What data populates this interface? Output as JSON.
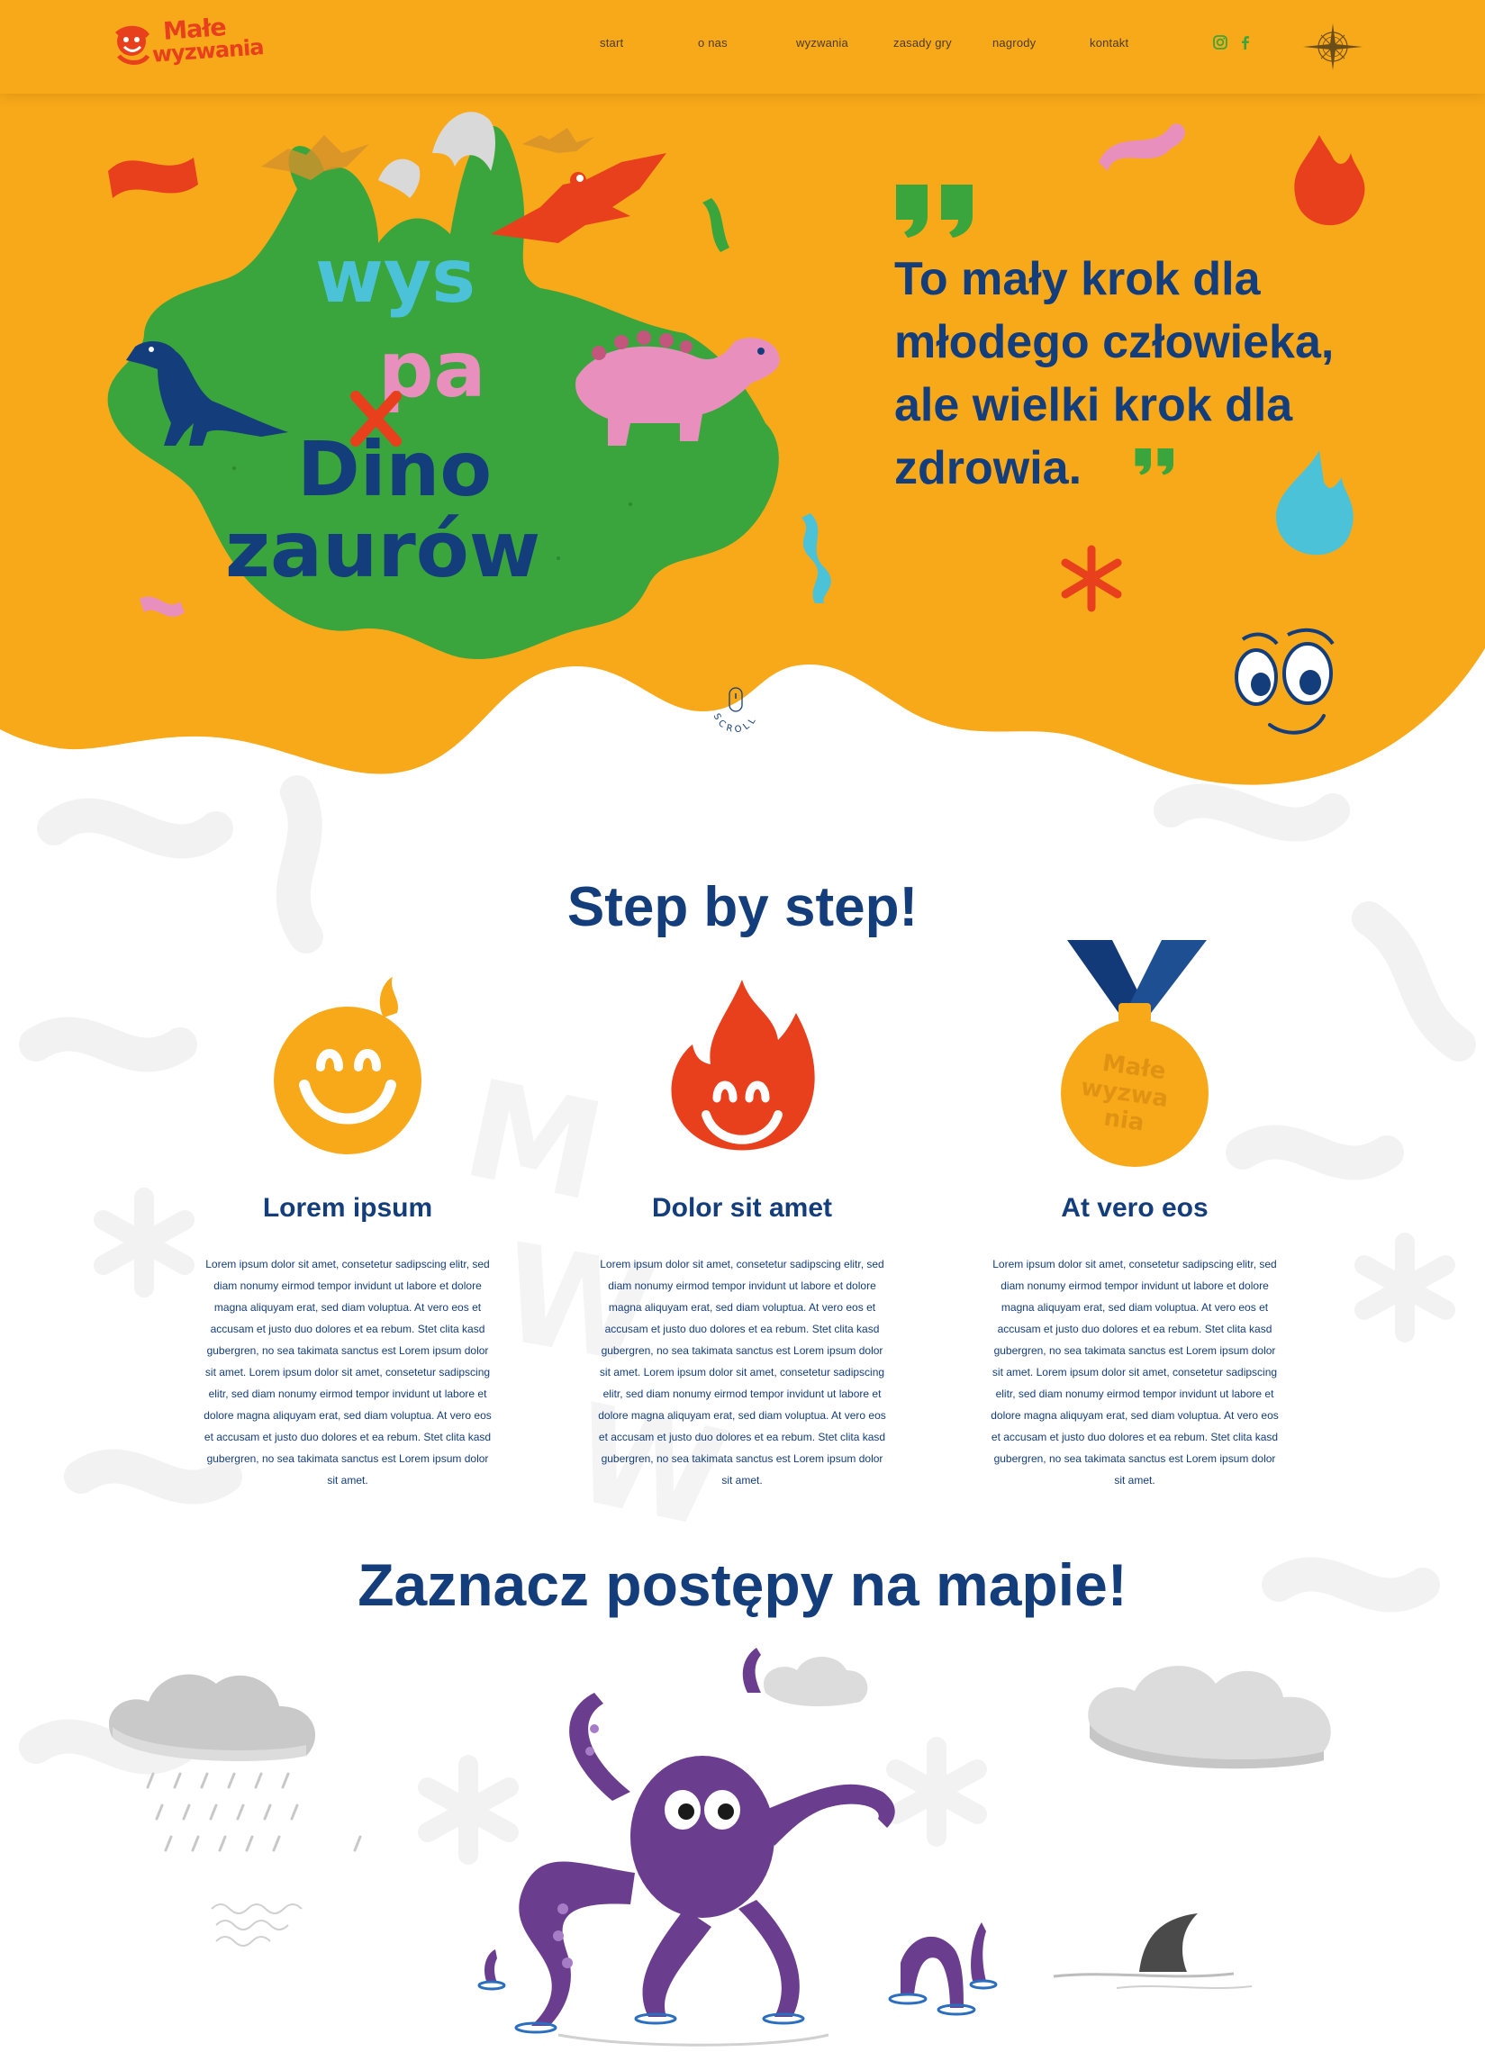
{
  "logo": {
    "line1": "Małe",
    "line2": "wyzwania"
  },
  "nav": [
    {
      "label": "start"
    },
    {
      "label": "o nas"
    },
    {
      "label": "wyzwania"
    },
    {
      "label": "zasady gry"
    },
    {
      "label": "nagrody"
    },
    {
      "label": "kontakt"
    }
  ],
  "social": [
    "instagram-icon",
    "facebook-icon"
  ],
  "hero": {
    "island_title": [
      "wys",
      "pa",
      "Dino",
      "zaurów"
    ],
    "quote": "To mały krok dla młodego człowieka, ale wielki krok dla zdrowia.",
    "scroll_label": "SCROLL"
  },
  "steps_section": {
    "title": "Step by step!",
    "steps": [
      {
        "heading": "Lorem ipsum",
        "icon": "smiling-child-face-icon",
        "text": "Lorem ipsum dolor sit amet, consetetur sadipscing elitr, sed diam nonumy eirmod tempor invidunt ut labore et dolore magna aliquyam erat, sed diam voluptua. At vero eos et accusam et justo duo dolores et ea rebum. Stet clita kasd gubergren, no sea takimata sanctus est Lorem ipsum dolor sit amet. Lorem ipsum dolor sit amet, consetetur sadipscing elitr, sed diam nonumy eirmod tempor invidunt ut labore et dolore magna aliquyam erat, sed diam voluptua. At vero eos et accusam et justo duo dolores et ea rebum. Stet clita kasd gubergren, no sea takimata sanctus est Lorem ipsum dolor sit amet."
      },
      {
        "heading": "Dolor sit amet",
        "icon": "smiling-flame-icon",
        "text": "Lorem ipsum dolor sit amet, consetetur sadipscing elitr, sed diam nonumy eirmod tempor invidunt ut labore et dolore magna aliquyam erat, sed diam voluptua. At vero eos et accusam et justo duo dolores et ea rebum. Stet clita kasd gubergren, no sea takimata sanctus est Lorem ipsum dolor sit amet. Lorem ipsum dolor sit amet, consetetur sadipscing elitr, sed diam nonumy eirmod tempor invidunt ut labore et dolore magna aliquyam erat, sed diam voluptua. At vero eos et accusam et justo duo dolores et ea rebum. Stet clita kasd gubergren, no sea takimata sanctus est Lorem ipsum dolor sit amet."
      },
      {
        "heading": "At vero eos",
        "icon": "medal-icon",
        "text": "Lorem ipsum dolor sit amet, consetetur sadipscing elitr, sed diam nonumy eirmod tempor invidunt ut labore et dolore magna aliquyam erat, sed diam voluptua. At vero eos et accusam et justo duo dolores et ea rebum. Stet clita kasd gubergren, no sea takimata sanctus est Lorem ipsum dolor sit amet. Lorem ipsum dolor sit amet, consetetur sadipscing elitr, sed diam nonumy eirmod tempor invidunt ut labore et dolore magna aliquyam erat, sed diam voluptua. At vero eos et accusam et justo duo dolores et ea rebum. Stet clita kasd gubergren, no sea takimata sanctus est Lorem ipsum dolor sit amet."
      }
    ]
  },
  "map_section": {
    "title": "Zaznacz postępy na mapie!"
  },
  "colors": {
    "orange": "#f8a91a",
    "navy": "#143d7c",
    "red": "#e8401c",
    "green": "#3aa53c",
    "pink": "#e88fbd",
    "cyan": "#4bc2d8",
    "purple": "#6b3d8f"
  }
}
